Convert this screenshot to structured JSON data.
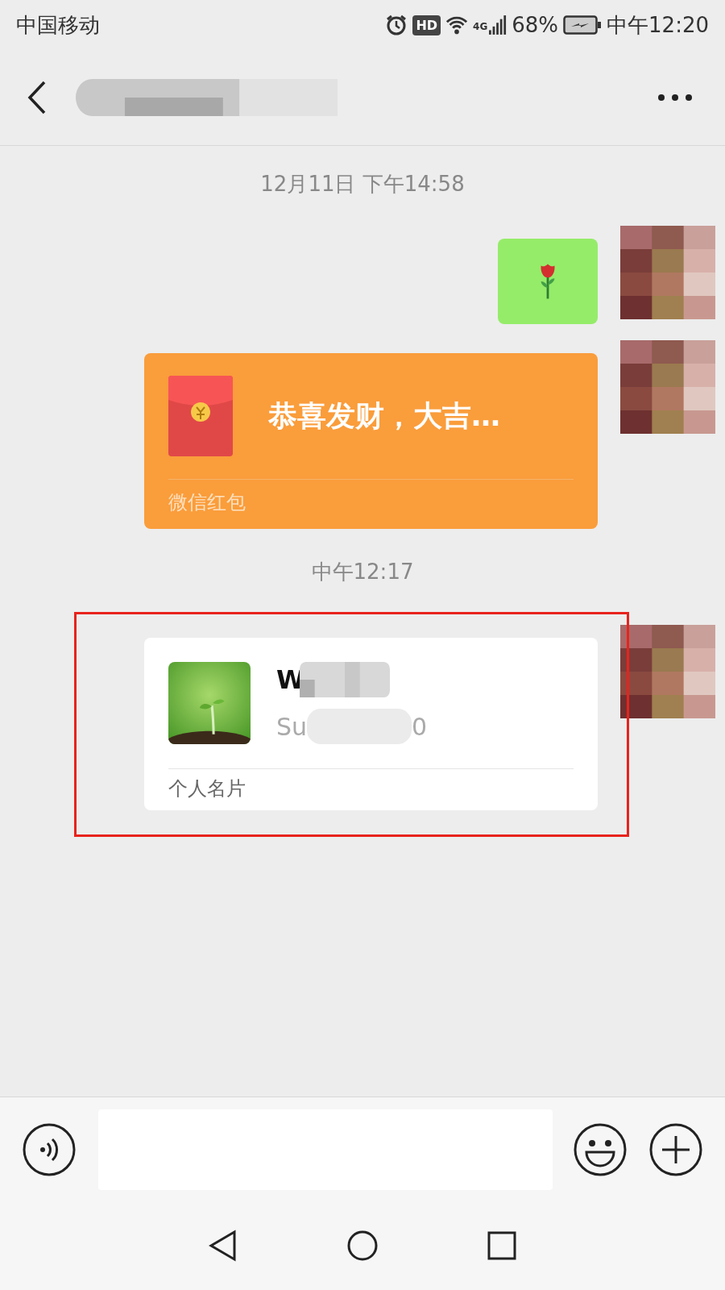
{
  "status_bar": {
    "carrier": "中国移动",
    "hd_badge": "HD",
    "network": "4G",
    "battery": "68%",
    "time": "中午12:20"
  },
  "messages": [
    {
      "kind": "timestamp",
      "text": "12月11日 下午14:58"
    },
    {
      "kind": "sticker"
    },
    {
      "kind": "red_packet",
      "title": "恭喜发财，大吉…",
      "footer": "微信红包"
    },
    {
      "kind": "timestamp",
      "text": "中午12:17"
    },
    {
      "kind": "contact_card",
      "name": "W",
      "id_start": "Su",
      "id_end": "0",
      "footer": "个人名片",
      "highlighted": true
    }
  ]
}
